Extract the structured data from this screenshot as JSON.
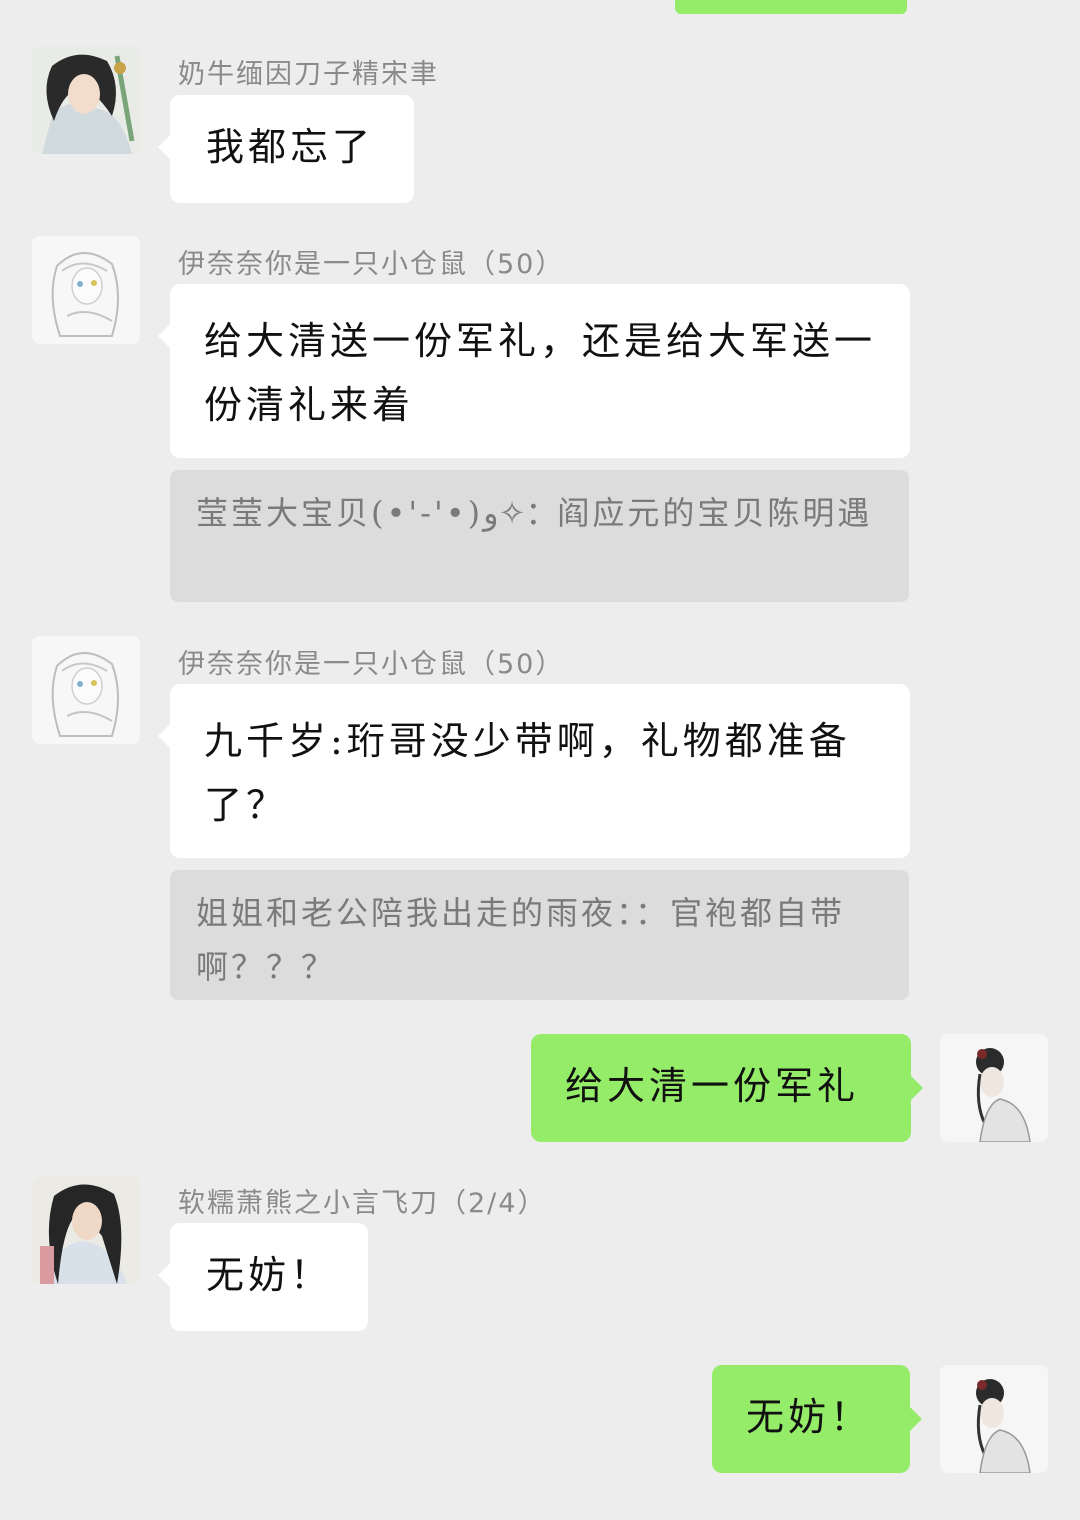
{
  "messages": [
    {
      "sender": "奶牛缅因刀子精宋聿",
      "text": "我都忘了"
    },
    {
      "sender": "伊奈奈你是一只小仓鼠（50）",
      "text": "给大清送一份军礼，还是给大军送一份清礼来着",
      "quote": "莹莹大宝贝(•'-'•)و✧：阎应元的宝贝陈明遇"
    },
    {
      "sender": "伊奈奈你是一只小仓鼠（50）",
      "text": "九千岁:珩哥没少带啊，礼物都准备了？",
      "quote": "姐姐和老公陪我出走的雨夜：：官袍都自带啊？？？"
    },
    {
      "self": true,
      "text": "给大清一份军礼"
    },
    {
      "sender": "软糯萧熊之小言飞刀（2/4）",
      "text": "无妨！"
    },
    {
      "self": true,
      "text": "无妨！"
    }
  ],
  "colors": {
    "background": "#ededed",
    "self_bubble": "#95ec69",
    "other_bubble": "#ffffff",
    "quote_bg": "#dcdcdc",
    "sender_text": "#8a8a8a"
  },
  "icons": {
    "avatar_1": "ink-swordsman-portrait",
    "avatar_2": "sketch-white-hair-girl",
    "avatar_self": "ink-girl-with-hairpiece",
    "avatar_5": "ink-long-hair-man"
  }
}
